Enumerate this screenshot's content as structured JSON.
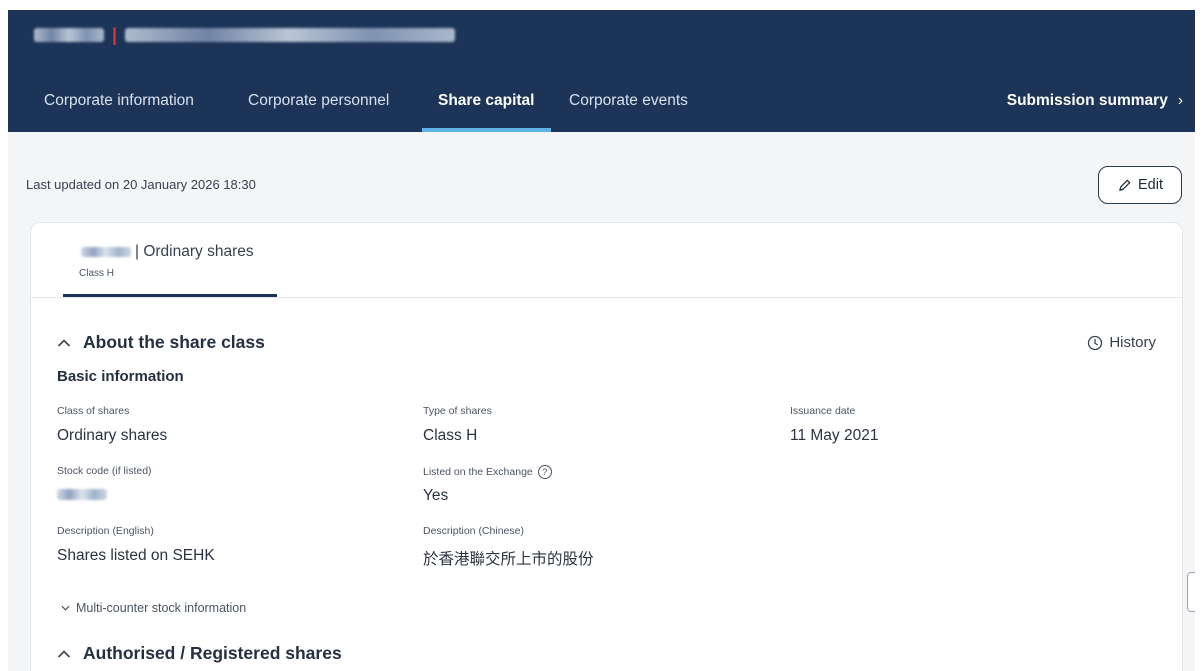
{
  "header": {
    "nav_tabs": [
      {
        "label": "Corporate information"
      },
      {
        "label": "Corporate personnel"
      },
      {
        "label": "Share capital"
      },
      {
        "label": "Corporate events"
      }
    ],
    "summary_label": "Submission summary",
    "summary_chevron": "›"
  },
  "toolbar": {
    "last_updated": "Last updated on 20 January 2026 18:30",
    "edit_label": "Edit"
  },
  "share_class_tab": {
    "title_suffix": "| Ordinary shares",
    "subtitle": "Class H"
  },
  "about_section": {
    "title": "About the share class",
    "history_label": "History",
    "basic_heading": "Basic information",
    "fields": {
      "class_of_shares": {
        "label": "Class of shares",
        "value": "Ordinary shares"
      },
      "type_of_shares": {
        "label": "Type of shares",
        "value": "Class H"
      },
      "issuance_date": {
        "label": "Issuance date",
        "value": "11 May 2021"
      },
      "stock_code": {
        "label": "Stock code (if listed)"
      },
      "listed_on_exchange": {
        "label": "Listed on the Exchange",
        "value": "Yes"
      },
      "description_en": {
        "label": "Description (English)",
        "value": "Shares listed on SEHK"
      },
      "description_zh": {
        "label": "Description (Chinese)",
        "value": "於香港聯交所上市的股份"
      }
    },
    "multi_counter_label": "Multi-counter stock information"
  },
  "authorised_section": {
    "title": "Authorised / Registered shares"
  },
  "icons": {
    "edit": "pencil-icon",
    "history": "clock-icon",
    "help": "question-circle-icon",
    "collapse": "chevron-up-icon",
    "expand": "chevron-down-icon"
  },
  "colors": {
    "header_bg": "#1c3457",
    "active_tab_underline": "#5bb4e5",
    "brand_separator": "#e2332f"
  }
}
